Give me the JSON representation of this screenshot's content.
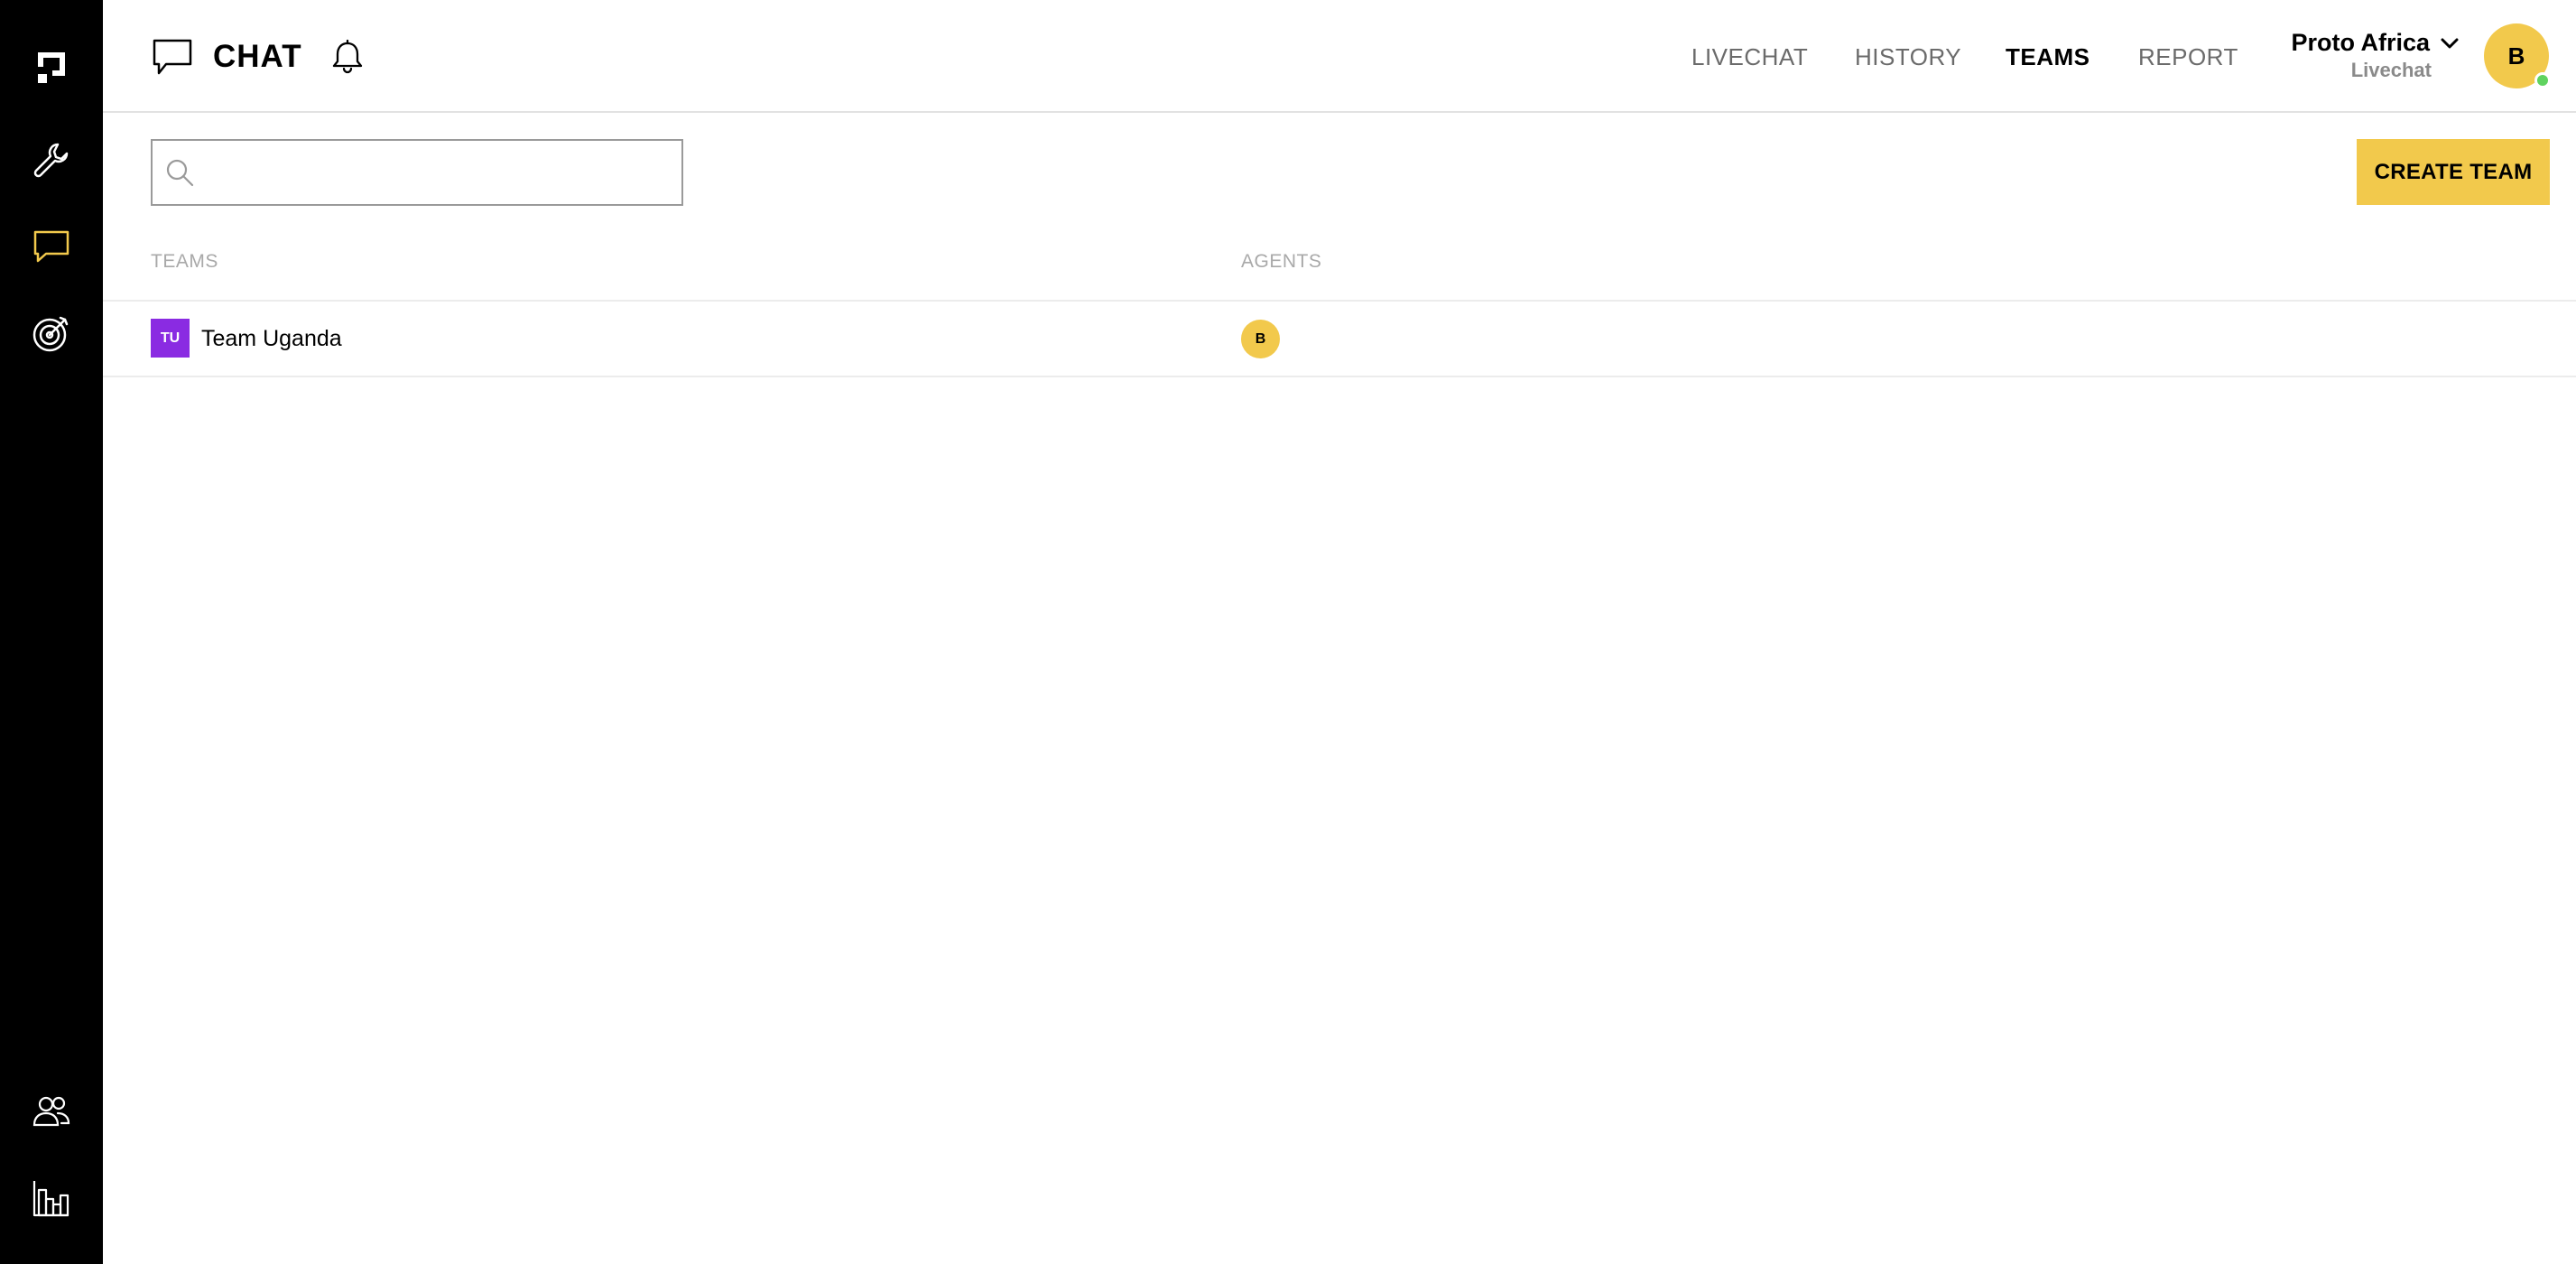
{
  "colors": {
    "rail_bg": "#000000",
    "accent_yellow": "#f2c94c",
    "team_badge_purple": "#8a2be2",
    "presence_green": "#5fd35f"
  },
  "rail": {
    "items": [
      {
        "icon": "logo-icon",
        "active": false
      },
      {
        "icon": "wrench-icon",
        "active": false
      },
      {
        "icon": "chat-bubble-icon",
        "active": true
      },
      {
        "icon": "target-icon",
        "active": false
      },
      {
        "icon": "users-icon",
        "active": false
      },
      {
        "icon": "bar-chart-icon",
        "active": false
      }
    ]
  },
  "header": {
    "title": "CHAT",
    "nav": [
      {
        "label": "LIVECHAT",
        "active": false
      },
      {
        "label": "HISTORY",
        "active": false
      },
      {
        "label": "TEAMS",
        "active": true
      },
      {
        "label": "REPORT",
        "active": false
      }
    ],
    "workspace": {
      "name": "Proto Africa",
      "sub": "Livechat"
    },
    "user_avatar_initial": "B",
    "user_online": true
  },
  "toolbar": {
    "search_placeholder": "",
    "search_value": "",
    "create_label": "CREATE TEAM"
  },
  "table": {
    "columns": [
      "TEAMS",
      "AGENTS"
    ],
    "rows": [
      {
        "badge": "TU",
        "name": "Team Uganda",
        "agents": [
          "B"
        ]
      }
    ]
  }
}
